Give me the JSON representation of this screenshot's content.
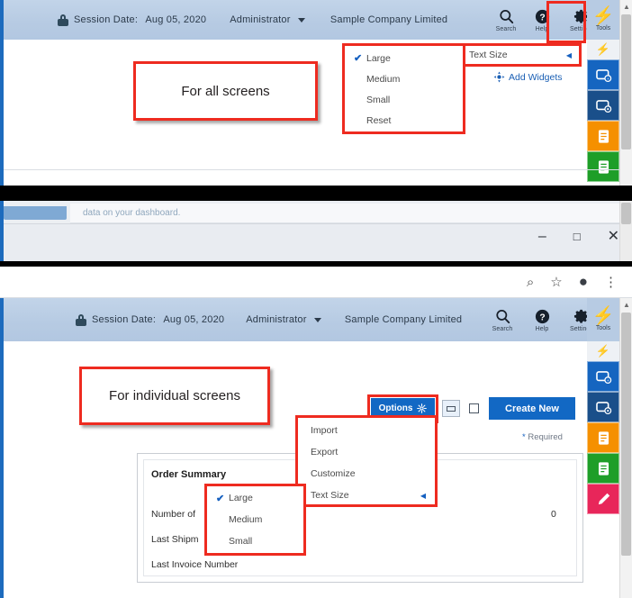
{
  "colors": {
    "header_blue": "#b7cbe3",
    "accent_blue": "#1268c4",
    "annotation_red": "#ee2b20",
    "rail_blue": "#1565c0",
    "rail_darkblue": "#1a4f8a",
    "rail_orange": "#f59000",
    "rail_green": "#1e9e28",
    "rail_pink": "#e8265a"
  },
  "top_app": {
    "header": {
      "lock_icon": "lock-icon",
      "session_label": "Session Date:",
      "session_date": "Aug 05, 2020",
      "user": "Administrator",
      "company": "Sample Company Limited",
      "actions": [
        {
          "icon": "search-icon",
          "label": "Search"
        },
        {
          "icon": "help-icon",
          "label": "Help"
        },
        {
          "icon": "gear-icon",
          "label": "Settings"
        },
        {
          "icon": "bolt-icon",
          "label": "Tools"
        }
      ]
    },
    "annotation": "For all screens",
    "text_size_pill": {
      "label": "Text Size",
      "arrow": "caret-left-icon"
    },
    "text_size_menu": [
      {
        "label": "Large",
        "checked": true
      },
      {
        "label": "Medium",
        "checked": false
      },
      {
        "label": "Small",
        "checked": false
      },
      {
        "label": "Reset",
        "checked": false
      }
    ],
    "add_widgets": {
      "icon": "widget-icon",
      "label": "Add Widgets"
    }
  },
  "browser": {
    "page_text": "data on your dashboard.",
    "window_controls": [
      {
        "icon": "minimize-icon",
        "glyph": "–"
      },
      {
        "icon": "maximize-icon",
        "glyph": "□"
      },
      {
        "icon": "close-icon",
        "glyph": "✕"
      }
    ],
    "toolbar_icons": [
      {
        "icon": "zoom-out-icon",
        "glyph": "⌕"
      },
      {
        "icon": "bookmark-star-icon",
        "glyph": "☆"
      },
      {
        "icon": "profile-avatar-icon",
        "glyph": "●"
      },
      {
        "icon": "overflow-menu-icon",
        "glyph": "⋮"
      }
    ]
  },
  "bottom_app": {
    "header": {
      "lock_icon": "lock-icon",
      "session_label": "Session Date:",
      "session_date": "Aug 05, 2020",
      "user": "Administrator",
      "company": "Sample Company Limited",
      "actions": [
        {
          "icon": "search-icon",
          "label": "Search"
        },
        {
          "icon": "help-icon",
          "label": "Help"
        },
        {
          "icon": "gear-icon",
          "label": "Settings"
        },
        {
          "icon": "bolt-icon",
          "label": "Tools"
        }
      ]
    },
    "annotation": "For individual screens",
    "options_button": {
      "label": "Options",
      "icon": "gear-icon"
    },
    "panel_buttons": [
      {
        "icon": "collapse-panel-icon"
      },
      {
        "icon": "expand-panel-icon"
      }
    ],
    "create_new_button": "Create New",
    "required_note": "Required",
    "required_star": "*",
    "options_menu": [
      {
        "label": "Import",
        "submenu": false
      },
      {
        "label": "Export",
        "submenu": false
      },
      {
        "label": "Customize",
        "submenu": false
      },
      {
        "label": "Text Size",
        "submenu": true
      }
    ],
    "text_size_menu": [
      {
        "label": "Large",
        "checked": true
      },
      {
        "label": "Medium",
        "checked": false
      },
      {
        "label": "Small",
        "checked": false
      }
    ],
    "order_summary": {
      "title": "Order Summary",
      "rows": [
        {
          "label": "Number of",
          "value": "0"
        },
        {
          "label": "Last Shipm",
          "value": ""
        },
        {
          "label": "Last Invoice Number",
          "value": ""
        }
      ]
    }
  },
  "rails": {
    "top_items": [
      {
        "icon": "bolt-icon",
        "color": "#eef1f5"
      },
      {
        "icon": "device-add-icon",
        "color": "#1565c0"
      },
      {
        "icon": "device-clock-icon",
        "color": "#1a4f8a"
      },
      {
        "icon": "note-orange-icon",
        "color": "#f59000"
      },
      {
        "icon": "doc-green-icon",
        "color": "#1e9e28"
      }
    ],
    "bottom_items": [
      {
        "icon": "bolt-icon",
        "color": "#eef1f5"
      },
      {
        "icon": "device-add-icon",
        "color": "#1565c0"
      },
      {
        "icon": "device-clock-icon",
        "color": "#1a4f8a"
      },
      {
        "icon": "note-orange-icon",
        "color": "#f59000"
      },
      {
        "icon": "doc-green-icon",
        "color": "#1e9e28"
      },
      {
        "icon": "pen-pink-icon",
        "color": "#e8265a"
      }
    ]
  }
}
